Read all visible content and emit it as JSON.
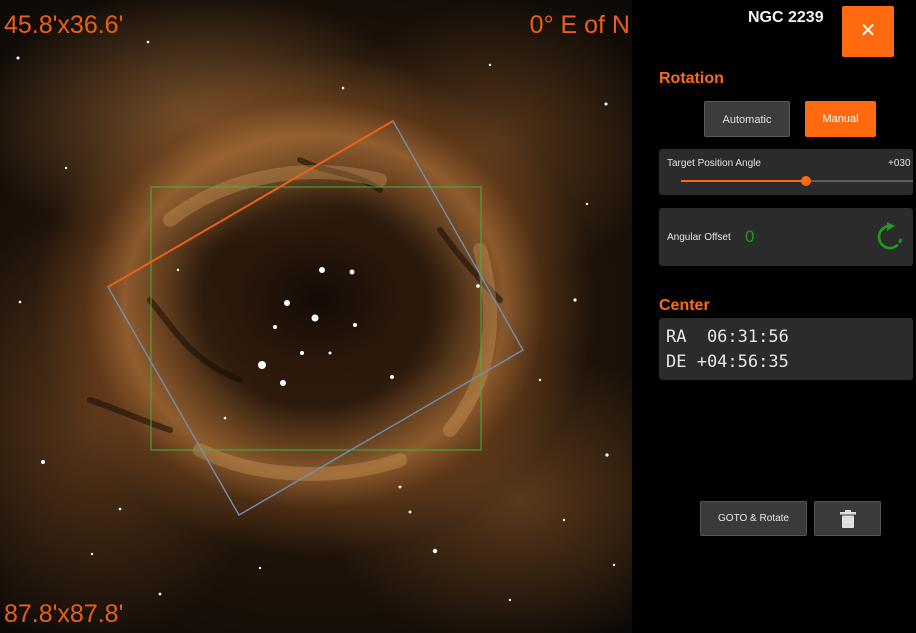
{
  "sky": {
    "fov_size": "45.8'x36.6'",
    "position_angle": "0° E of N",
    "image_size": "87.8'x87.8'"
  },
  "panel": {
    "object_name": "NGC 2239",
    "close_icon": "close-icon",
    "rotation": {
      "title": "Rotation",
      "automatic_label": "Automatic",
      "manual_label": "Manual",
      "selected": "Manual",
      "target_pa_label": "Target Position Angle",
      "target_pa_value": "+030",
      "slider_fraction": 0.54,
      "angular_offset_label": "Angular Offset",
      "angular_offset_value": "0",
      "reset_icon": "rotate-reset-icon"
    },
    "center": {
      "title": "Center",
      "ra": "RA  06:31:56",
      "de": "DE +04:56:35"
    },
    "goto_label": "GOTO & Rotate",
    "delete_icon": "trash-icon"
  },
  "colors": {
    "accent": "#ff6a0f",
    "offset_green": "#1f9a1f",
    "fov_green": "#3fb23f",
    "frame_blue": "#6f8fb5"
  }
}
